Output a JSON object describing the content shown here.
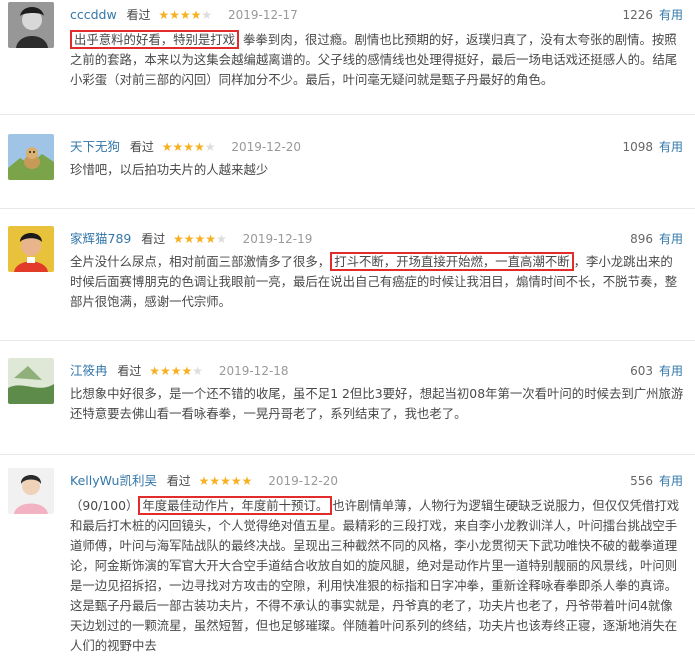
{
  "labels": {
    "seen": "看过",
    "useful": "有用"
  },
  "colors": {
    "author_link": "#3377aa",
    "star": "#f7b120",
    "highlight_border": "#e22b2b"
  },
  "reviews": [
    {
      "author": "cccddw",
      "rating": 4,
      "date": "2019-12-17",
      "votes": "1226",
      "highlight": "出乎意料的好看，特别是打戏",
      "text": "拳拳到肉，很过瘾。剧情也比预期的好，返璞归真了，没有太夸张的剧情。按照之前的套路，本来以为这集会越编越离谱的。父子线的感情线也处理得挺好，最后一场电话戏还挺感人的。结尾小彩蛋（对前三部的闪回）同样加分不少。最后，叶问毫无疑问就是甄子丹最好的角色。"
    },
    {
      "author": "天下无狗",
      "rating": 4,
      "date": "2019-12-20",
      "votes": "1098",
      "text": "珍惜吧，以后拍功夫片的人越来越少"
    },
    {
      "author": "家辉猫789",
      "rating": 4,
      "date": "2019-12-19",
      "votes": "896",
      "text_before": "全片没什么尿点，相对前面三部激情多了很多，",
      "highlight": "打斗不断，开场直接开始燃，一直高潮不断",
      "text": "，李小龙跳出来的时候后面赛博朋克的色调让我眼前一亮，最后在说出自己有癌症的时候让我泪目，煽情时间不长，不脱节奏，整部片很饱满，感谢一代宗师。"
    },
    {
      "author": "江筱冉",
      "rating": 4,
      "date": "2019-12-18",
      "votes": "603",
      "text": "比想象中好很多，是一个还不错的收尾，虽不足1 2但比3要好，想起当初08年第一次看叶问的时候去到广州旅游还特意要去佛山看一看咏春拳，一晃丹哥老了，系列结束了，我也老了。"
    },
    {
      "author": "KellyWu凯利吴",
      "rating": 5,
      "date": "2019-12-20",
      "votes": "556",
      "text_before": "（90/100）",
      "highlight": "年度最佳动作片，年度前十预订。",
      "text": "也许剧情单薄，人物行为逻辑生硬缺乏说服力，但仅仅凭借打戏和最后打木桩的闪回镜头，个人觉得绝对值五星。最精彩的三段打戏，来自李小龙教训洋人，叶问擂台挑战空手道师傅，叶问与海军陆战队的最终决战。呈现出三种截然不同的风格，李小龙贯彻天下武功唯快不破的截拳道理论，阿金斯饰演的军官大开大合空手道结合收放自如的旋风腿，绝对是动作片里一道特别靓丽的风景线，叶问则是一边见招拆招，一边寻找对方攻击的空隙，利用快准狠的标指和日字冲拳，重新诠释咏春拳即杀人拳的真谛。这是甄子丹最后一部古装功夫片，不得不承认的事实就是，丹爷真的老了，功夫片也老了，丹爷带着叶问4就像天边划过的一颗流星，虽然短暂，但也足够璀璨。伴随着叶问系列的终结，功夫片也该寿终正寝，逐渐地消失在人们的视野中去"
    }
  ]
}
